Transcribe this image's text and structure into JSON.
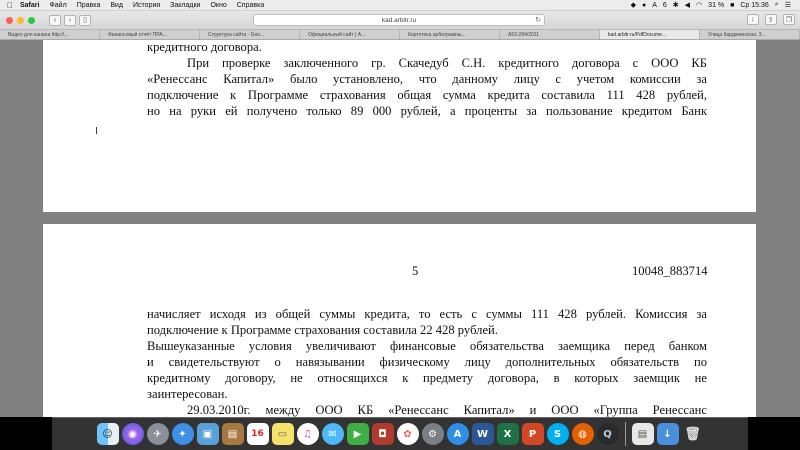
{
  "menubar": {
    "apple": "",
    "items": [
      "Safari",
      "Файл",
      "Правка",
      "Вид",
      "История",
      "Закладки",
      "Окно",
      "Справка"
    ],
    "status": {
      "battery": "31 %",
      "day_time": "Ср 15:36",
      "cyrillic_indicator": "А",
      "count": "6"
    }
  },
  "toolbar": {
    "back": "‹",
    "forward": "›",
    "sidebar_icon": "sidebar-icon",
    "address": "kad.arbitr.ru",
    "reload": "↻"
  },
  "tabs": [
    "Видео для канала http://...",
    "Финансовый отчёт ПРА...",
    "Структура сайта - Goo...",
    "Официальный сайт | А...",
    "Картотека арбитражны...",
    "А53-284/2011",
    "kad.arbitr.ru/PdfDocume...",
    "Улица Кардачинская, 3..."
  ],
  "document": {
    "page1_lines": [
      "кредитного договора.",
      "При проверке заключенного гр. Скачедуб С.Н. кредитного договора с ООО КБ",
      "«Ренессанс Капитал» было установлено, что данному лицу с учетом комиссии за",
      "подключение к Программе страхования общая сумма кредита составила 111 428 рублей,",
      "но на руки ей получено только 89 000 рублей, а проценты за пользование кредитом Банк"
    ],
    "page_number": "5",
    "doc_number": "10048_883714",
    "page2_lines": [
      "начисляет исходя из общей суммы кредита, то есть с суммы 111 428 рублей. Комиссия за",
      "подключение к Программе страхования составила 22 428 рублей.",
      "Вышеуказанные условия увеличивают финансовые обязательства заемщика перед банком",
      "и свидетельствуют о навязывании физическому лицу дополнительных обязательств по",
      "кредитному договору, не относящихся к предмету договора, в которых заемщик не",
      "заинтересован.",
      "29.03.2010г. между ООО КБ «Ренессанс Капитал» и ООО «Группа Ренессанс"
    ],
    "cursor": "I"
  },
  "dock": {
    "calendar_day": "16",
    "apps": [
      "finder-icon",
      "siri-icon",
      "launchpad-icon",
      "safari-icon",
      "preview-icon",
      "notes-icon",
      "calendar-icon",
      "stickies-icon",
      "itunes-icon",
      "messages-icon",
      "facetime-icon",
      "photo-booth-icon",
      "photos-icon",
      "system-preferences-icon",
      "app-store-icon",
      "word-icon",
      "excel-icon",
      "powerpoint-icon",
      "skype-icon",
      "firefox-icon",
      "quicktime-icon",
      "document-icon",
      "downloads-icon",
      "trash-icon"
    ]
  }
}
